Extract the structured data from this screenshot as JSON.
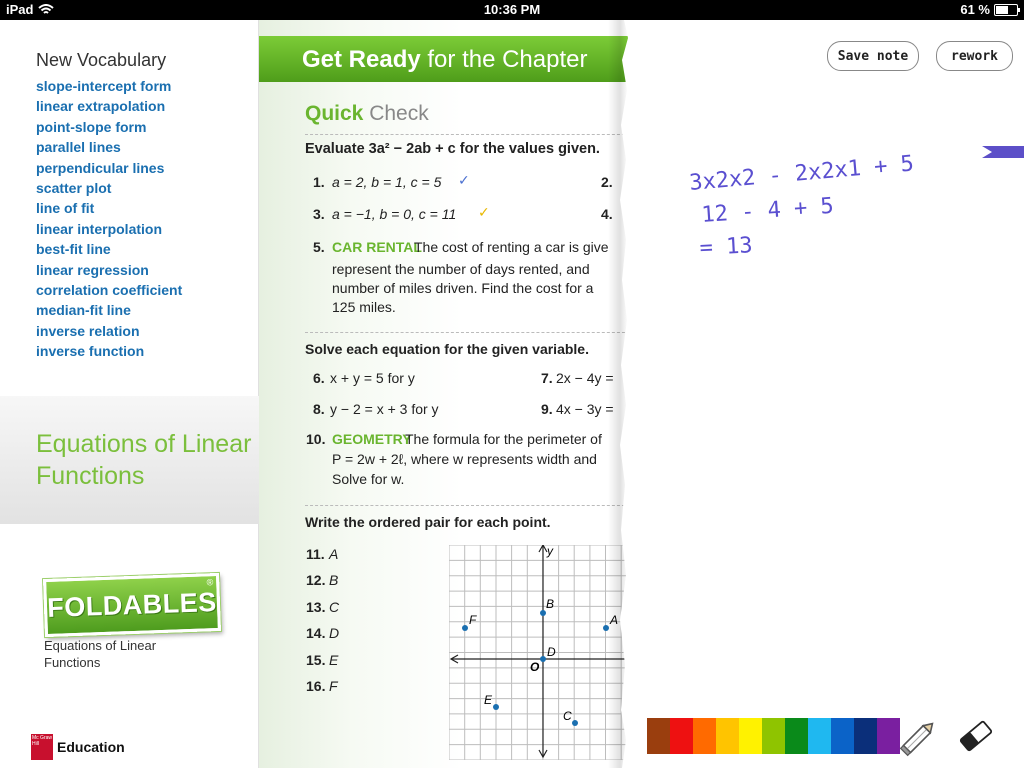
{
  "status_bar": {
    "device": "iPad",
    "time": "10:36 PM",
    "battery": "61 %"
  },
  "sidebar": {
    "vocab_title": "New Vocabulary",
    "vocab_terms": [
      "slope-intercept form",
      "linear extrapolation",
      "point-slope form",
      "parallel lines",
      "perpendicular lines",
      "scatter plot",
      "line of fit",
      "linear interpolation",
      "best-fit line",
      "linear regression",
      "correlation coefficient",
      "median-fit line",
      "inverse relation",
      "inverse function"
    ],
    "chapter_tab": "Equations of Linear Functions",
    "foldables_logo": "FOLDABLES",
    "foldables_reg": "®",
    "foldables_caption": "Equations of Linear Functions",
    "publisher": "Education",
    "publisher_mark": "Mc Graw Hill"
  },
  "book": {
    "banner_bold": "Get Ready",
    "banner_rest": "for the Chapter",
    "qc_bold": "Quick",
    "qc_rest": "Check",
    "evaluate_prompt": "Evaluate 3a² − 2ab + c for the values given.",
    "items": {
      "i1": "1.",
      "i1_text": "a = 2, b = 1, c = 5",
      "i1_check": "✓",
      "i2": "2.",
      "i3": "3.",
      "i3_text": "a = −1, b = 0, c = 11",
      "i3_check": "✓",
      "i4": "4.",
      "i5": "5.",
      "i5_label": "CAR RENTAL",
      "i5_l1": "The cost of renting a car is give",
      "i5_l2": "represent the number of days rented, and",
      "i5_l3": "number of miles driven. Find the cost for a",
      "i5_l4": "125 miles."
    },
    "solve_prompt": "Solve each equation for the given variable.",
    "solve": {
      "i6": "6.",
      "i6_text": "x + y = 5 for y",
      "i7": "7.",
      "i7_text": "2x − 4y =",
      "i8": "8.",
      "i8_text": "y − 2 = x + 3 for y",
      "i9": "9.",
      "i9_text": "4x − 3y =",
      "i10": "10.",
      "i10_label": "GEOMETRY",
      "i10_l1": "The formula for the perimeter of",
      "i10_l2": "P = 2w + 2ℓ, where w represents width and",
      "i10_l3": "Solve for w."
    },
    "ordered_prompt": "Write the ordered pair for each point.",
    "points": [
      {
        "num": "11.",
        "letter": "A"
      },
      {
        "num": "12.",
        "letter": "B"
      },
      {
        "num": "13.",
        "letter": "C"
      },
      {
        "num": "14.",
        "letter": "D"
      },
      {
        "num": "15.",
        "letter": "E"
      },
      {
        "num": "16.",
        "letter": "F"
      }
    ],
    "graph_labels": {
      "y": "y",
      "o": "O",
      "A": "A",
      "B": "B",
      "C": "C",
      "D": "D",
      "E": "E",
      "F": "F"
    }
  },
  "note_panel": {
    "save_label": "Save note",
    "rework_label": "rework",
    "handwriting": [
      "3x2x2 - 2x2x1 + 5",
      "12 - 4 + 5",
      "= 13"
    ],
    "ink_color": "#5a4fd0",
    "palette": [
      "#9a3e0e",
      "#ee1111",
      "#ff6a00",
      "#ffc400",
      "#fff200",
      "#8fc400",
      "#0a8a1a",
      "#1fb8f0",
      "#0b63c8",
      "#0b2f7a",
      "#7a1fa0"
    ],
    "tools": [
      "pencil-icon",
      "eraser-icon"
    ]
  }
}
